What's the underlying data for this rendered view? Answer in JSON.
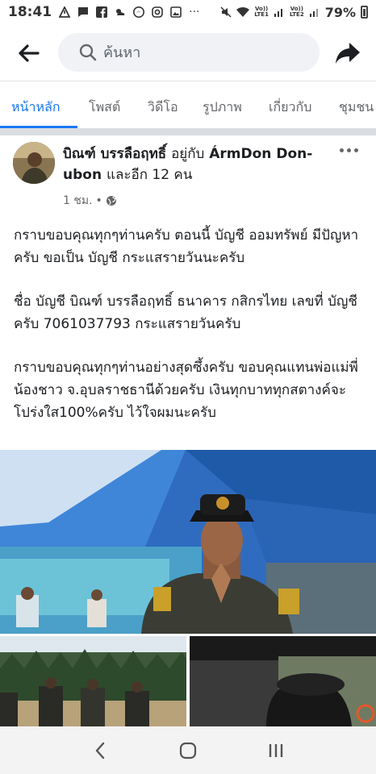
{
  "status_bar": {
    "time": "18:41",
    "network_1": "LTE1",
    "network_2": "LTE2",
    "volte": "Vo))",
    "battery": "79%",
    "more": "···"
  },
  "header": {
    "search_placeholder": "ค้นหา"
  },
  "tabs": [
    {
      "label": "หน้าหลัก",
      "active": true
    },
    {
      "label": "โพสต์"
    },
    {
      "label": "วิดีโอ"
    },
    {
      "label": "รูปภาพ"
    },
    {
      "label": "เกี่ยวกับ"
    },
    {
      "label": "ชุมชน"
    }
  ],
  "post": {
    "author_name": "บิณฑ์ บรรลือฤทธิ์",
    "with_text": "อยู่กับ",
    "tagged": "ÁrmDon Don-ubon",
    "and_text": "และอีก 12 คน",
    "time": "1 ชม.",
    "separator": "•",
    "paragraphs": [
      "กราบขอบคุณทุกๆท่านครับ  ตอนนี้ บัญชี ออมทรัพย์ มีปัญหาครับ  ขอเป็น บัญชี กระแสรายวันนะครับ",
      "ชื่อ บัญชี บิณฑ์ บรรลือฤทธิ์  ธนาคาร กสิกรไทย เลขที่ บัญชีครับ 7061037793 กระแสรายวันครับ",
      "กราบขอบคุณทุกๆท่านอย่างสุดซึ้งครับ  ขอบคุณแทนพ่อแม่พี่น้องชาว จ.อุบลราชธานีด้วยครับ เงินทุกบาททุกสตางค์จะโปร่งใส100%ครับ  ไว้ใจผมนะครับ"
    ]
  },
  "colors": {
    "accent": "#1877f2",
    "text": "#1c1e21",
    "secondary_text": "#65676b",
    "search_bg": "#f0f2f5"
  }
}
